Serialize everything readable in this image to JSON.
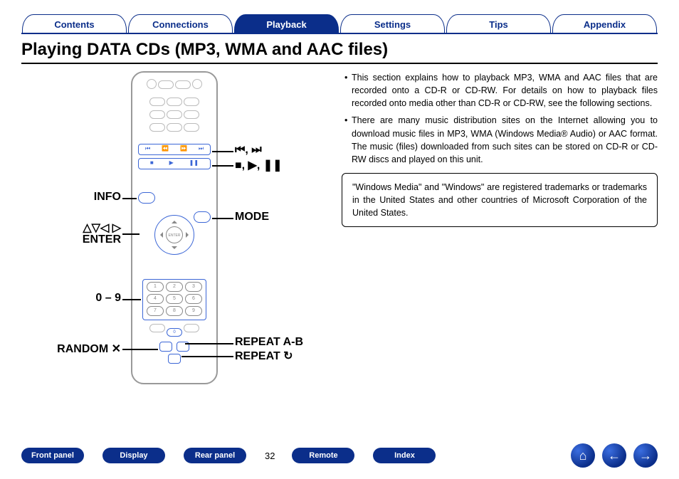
{
  "tabs": {
    "t0": "Contents",
    "t1": "Connections",
    "t2": "Playback",
    "t3": "Settings",
    "t4": "Tips",
    "t5": "Appendix",
    "activeIndex": 2
  },
  "title": "Playing DATA CDs (MP3, WMA and AAC files)",
  "callouts": {
    "skip": "⏮, ⏭",
    "transport": "■, ▶, ❚❚",
    "info": "INFO",
    "mode": "MODE",
    "arrows": "△▽◁ ▷",
    "enter": "ENTER",
    "numbers": "0 – 9",
    "random": "RANDOM ✕",
    "repeat_ab": "REPEAT A-B",
    "repeat": "REPEAT ↻"
  },
  "remote": {
    "enter_label": "ENTER",
    "keys": [
      "1",
      "2",
      "3",
      "4",
      "5",
      "6",
      "7",
      "8",
      "9"
    ]
  },
  "body": {
    "b1": "This section explains how to playback MP3, WMA and AAC files that are recorded onto a CD-R or CD-RW. For details on how to playback files recorded onto media other than CD-R or CD-RW, see the following sections.",
    "b2": "There are many music distribution sites on the Internet allowing you to download music files in MP3, WMA (Windows Media® Audio) or AAC format. The music (files) downloaded from such sites can be stored on CD-R or CD-RW discs and played on this unit.",
    "trademark": "\"Windows Media\" and \"Windows\" are registered trademarks or trademarks in the United States and other countries of Microsoft Corporation of the United States."
  },
  "footer": {
    "b0": "Front panel",
    "b1": "Display",
    "b2": "Rear panel",
    "b3": "Remote",
    "b4": "Index",
    "page": "32"
  },
  "icons": {
    "home": "⌂",
    "prev": "←",
    "next": "→"
  }
}
